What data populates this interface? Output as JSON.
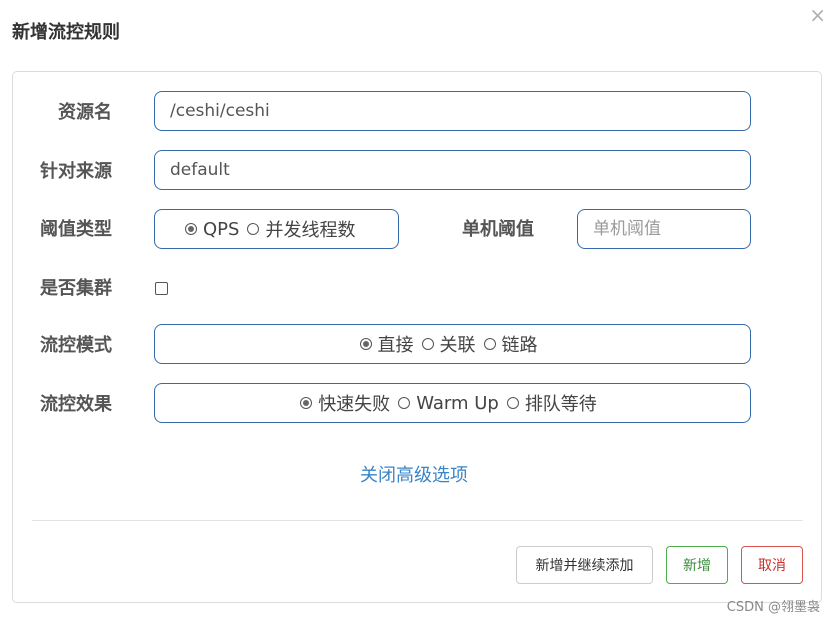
{
  "dialog": {
    "title": "新增流控规则",
    "close_label": "×"
  },
  "form": {
    "resource": {
      "label": "资源名",
      "value": "/ceshi/ceshi"
    },
    "limit_app": {
      "label": "针对来源",
      "value": "default"
    },
    "grade": {
      "label": "阈值类型",
      "options": [
        {
          "label": "QPS",
          "checked": true
        },
        {
          "label": "并发线程数",
          "checked": false
        }
      ]
    },
    "count": {
      "label": "单机阈值",
      "value": "",
      "placeholder": "单机阈值"
    },
    "cluster": {
      "label": "是否集群",
      "checked": false
    },
    "strategy": {
      "label": "流控模式",
      "options": [
        {
          "label": "直接",
          "checked": true
        },
        {
          "label": "关联",
          "checked": false
        },
        {
          "label": "链路",
          "checked": false
        }
      ]
    },
    "behavior": {
      "label": "流控效果",
      "options": [
        {
          "label": "快速失败",
          "checked": true
        },
        {
          "label": "Warm Up",
          "checked": false
        },
        {
          "label": "排队等待",
          "checked": false
        }
      ]
    },
    "advanced_toggle": "关闭高级选项"
  },
  "footer": {
    "add_continue": "新增并继续添加",
    "add": "新增",
    "cancel": "取消"
  },
  "watermark": "CSDN @翎墨袅"
}
